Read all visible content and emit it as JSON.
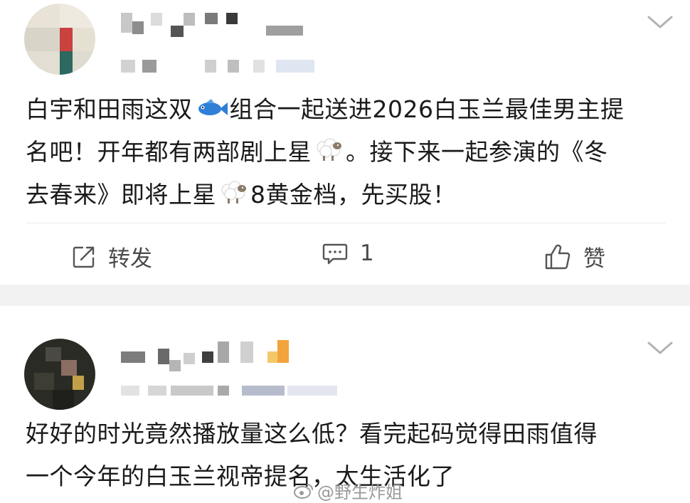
{
  "posts": [
    {
      "content_lines": [
        [
          "白宇和田雨这双",
          "fish",
          "组合一起送进2026白玉兰最佳男主提"
        ],
        [
          "名吧！开年都有两部剧上星",
          "sheep",
          "。接下来一起参演的《冬"
        ],
        [
          "去春来》即将上星",
          "sheep",
          "8黄金档，先买股！"
        ]
      ],
      "actions": {
        "repost_label": "转发",
        "comment_count": "1",
        "like_label": "赞"
      }
    },
    {
      "content_lines": [
        [
          "好好的时光竟然播放量这么低？看完起码觉得田雨值得"
        ],
        [
          "一个今年的白玉兰视帝提名，太生活化了"
        ]
      ]
    }
  ],
  "watermark": {
    "text": "@野生炸姐"
  },
  "icons": {
    "fish_emoji": "fish-icon",
    "sheep_emoji": "sheep-icon",
    "repost_icon": "share-icon",
    "comment_icon": "comment-icon",
    "like_icon": "thumbs-up-icon",
    "more_icon": "chevron-down-icon",
    "weibo_logo": "weibo-eye-icon"
  },
  "colors": {
    "text": "#1a1a1a",
    "muted": "#4a4a4a",
    "separator": "#f2f2f2",
    "watermark": "#9a9a9a"
  }
}
